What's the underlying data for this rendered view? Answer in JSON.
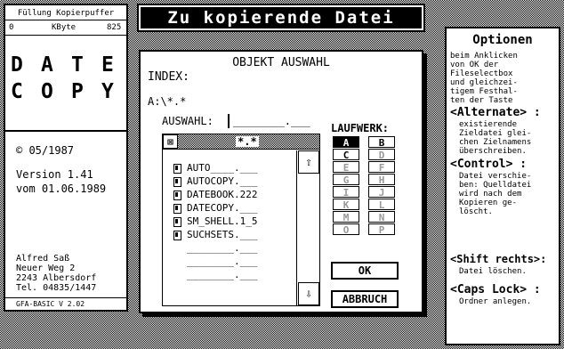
{
  "left_panel": {
    "buffer_title": "Füllung Kopierpuffer",
    "gauge_min": "0",
    "gauge_unit": "KByte",
    "gauge_max": "825",
    "buffer_fill_fraction": 0,
    "logo_row1": [
      "D",
      "A",
      "T",
      "E"
    ],
    "logo_row2": [
      "C",
      "O",
      "P",
      "Y"
    ],
    "copyright": "© 05/1987",
    "version": "Version 1.41",
    "date": "vom 01.06.1989",
    "author_name": "Alfred Saß",
    "author_street": "Neuer Weg 2",
    "author_city": "2243 Albersdorf",
    "author_phone": "Tel. 04835/1447",
    "footer": "GFA-BASIC V 2.02"
  },
  "title": "Zu kopierende Datei",
  "dialog": {
    "heading": "OBJEKT AUSWAHL",
    "index_label": "INDEX:",
    "path": "A:\\*.*______________________________",
    "auswahl_label": "AUSWAHL:",
    "auswahl_value": "________.___",
    "filter": "*.*",
    "files": [
      "AUTO____.___",
      "AUTOCOPY.___",
      "DATEBOOK.222",
      "DATECOPY.___",
      "SM_SHELL.1_5",
      "SUCHSETS.___",
      "________.___",
      "________.___",
      "________.___"
    ],
    "scroll_up": "⇧",
    "scroll_down": "⇩",
    "drive_label": "LAUFWERK:",
    "drives_left": [
      "A",
      "C",
      "E",
      "G",
      "I",
      "K",
      "M",
      "O"
    ],
    "drives_right": [
      "B",
      "D",
      "F",
      "H",
      "J",
      "L",
      "N",
      "P"
    ],
    "selected_drive": "A",
    "ok_label": "OK",
    "cancel_label": "ABBRUCH"
  },
  "right_panel": {
    "title": "Optionen",
    "intro": "beim Anklicken\nvon OK der\nFileselectbox\nund gleichzei-\ntigem Festhal-\nten der Taste",
    "options": [
      {
        "key": "<Alternate> :",
        "desc": "existierende\nZieldatei glei-\nchen Zielnamens\nüberschreiben."
      },
      {
        "key": "<Control> :",
        "desc": "Datei verschie-\nben: Quelldatei\nwird nach dem\nKopieren ge-\nlöscht."
      },
      {
        "key": "<Shift rechts>:",
        "desc": "Datei löschen."
      },
      {
        "key": "<Caps Lock> :",
        "desc": "Ordner anlegen."
      }
    ]
  }
}
